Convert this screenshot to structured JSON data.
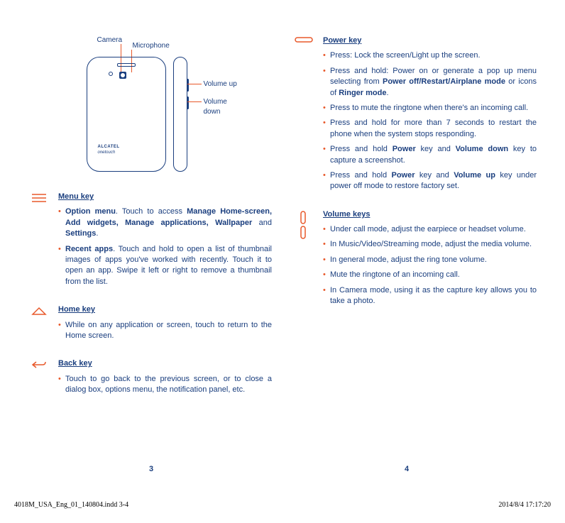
{
  "diagram": {
    "camera": "Camera",
    "microphone": "Microphone",
    "volume_up": "Volume up",
    "volume_down": "Volume down",
    "brand1": "ALCATEL",
    "brand2": "onetouch"
  },
  "left": {
    "menu": {
      "heading": "Menu key",
      "items": [
        {
          "pre": "",
          "bold": "Option menu",
          "post": ". Touch to access ",
          "bold2": "Manage Home-screen, Add widgets, Manage applications, Wallpaper",
          "post2": " and ",
          "bold3": "Settings",
          "post3": "."
        },
        {
          "pre": "",
          "bold": "Recent apps",
          "post": ". Touch and hold to open a list of thumbnail images of apps you've worked with recently. Touch it to open an app. Swipe it left or right to remove a thumbnail from the list."
        }
      ]
    },
    "home": {
      "heading": "Home key",
      "items": [
        {
          "text": "While on any application or screen,  touch to return to the Home screen."
        }
      ]
    },
    "back": {
      "heading": "Back key",
      "items": [
        {
          "text": "Touch to go back to the previous screen, or to close a dialog box, options menu, the notification panel, etc."
        }
      ]
    }
  },
  "right": {
    "power": {
      "heading": "Power key",
      "items": [
        {
          "text": "Press: Lock the screen/Light up the screen."
        },
        {
          "pre": "Press and hold: Power on or generate a pop up menu selecting from ",
          "bold": "Power off/Restart/Airplane mode",
          "post": " or icons of ",
          "bold2": "Ringer mode",
          "post2": "."
        },
        {
          "text": "Press to mute the ringtone when there's an incoming call."
        },
        {
          "text": "Press and hold for more than 7 seconds to restart the phone when the system stops responding."
        },
        {
          "pre": "Press and hold ",
          "bold": "Power",
          "post": " key and ",
          "bold2": "Volume down",
          "post2": " key to capture a screenshot."
        },
        {
          "pre": "Press and hold ",
          "bold": "Power",
          "post": " key and ",
          "bold2": "Volume up",
          "post2": " key under power off mode to restore factory set."
        }
      ]
    },
    "volume": {
      "heading": "Volume keys",
      "items": [
        {
          "text": "Under call mode, adjust the earpiece or headset volume."
        },
        {
          "text": "In Music/Video/Streaming mode, adjust the media volume."
        },
        {
          "text": "In general mode, adjust the ring tone volume."
        },
        {
          "text": "Mute the ringtone of an incoming call."
        },
        {
          "text": "In Camera mode, using it as the capture key allows you to take a photo."
        }
      ]
    }
  },
  "pages": {
    "left": "3",
    "right": "4"
  },
  "footer": {
    "file": "4018M_USA_Eng_01_140804.indd   3-4",
    "date": "2014/8/4   17:17:20"
  }
}
